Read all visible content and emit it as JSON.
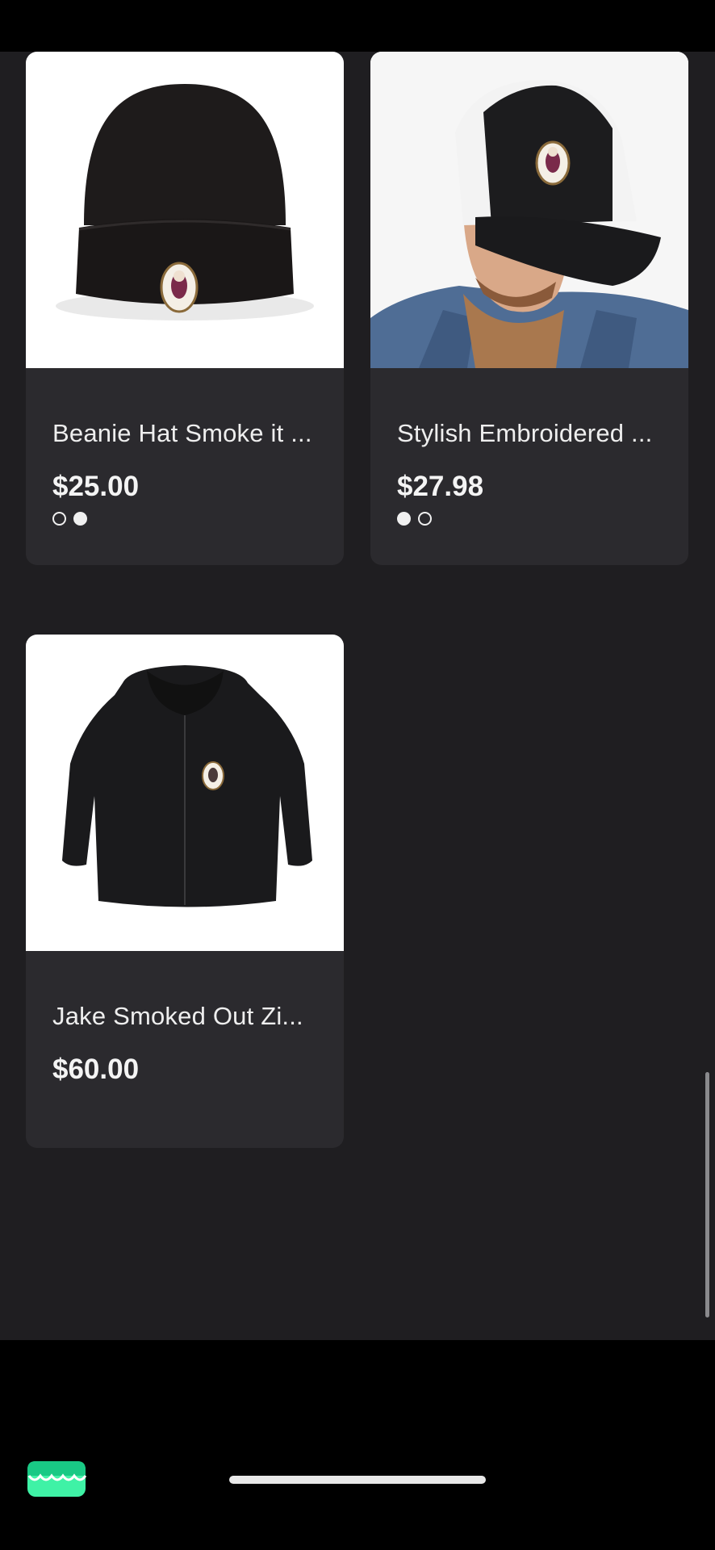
{
  "products": [
    {
      "title": "Beanie Hat Smoke it ...",
      "price": "$25.00",
      "swatches": [
        "outline",
        "filled"
      ]
    },
    {
      "title": "Stylish Embroidered ...",
      "price": "$27.98",
      "swatches": [
        "filled",
        "outline"
      ]
    },
    {
      "title": "Jake Smoked Out Zi...",
      "price": "$60.00",
      "swatches": []
    }
  ],
  "icons": {
    "app": "store-icon"
  },
  "colors": {
    "background": "#1f1e21",
    "card": "#2b2a2e",
    "accent": "#3ff2a6"
  }
}
